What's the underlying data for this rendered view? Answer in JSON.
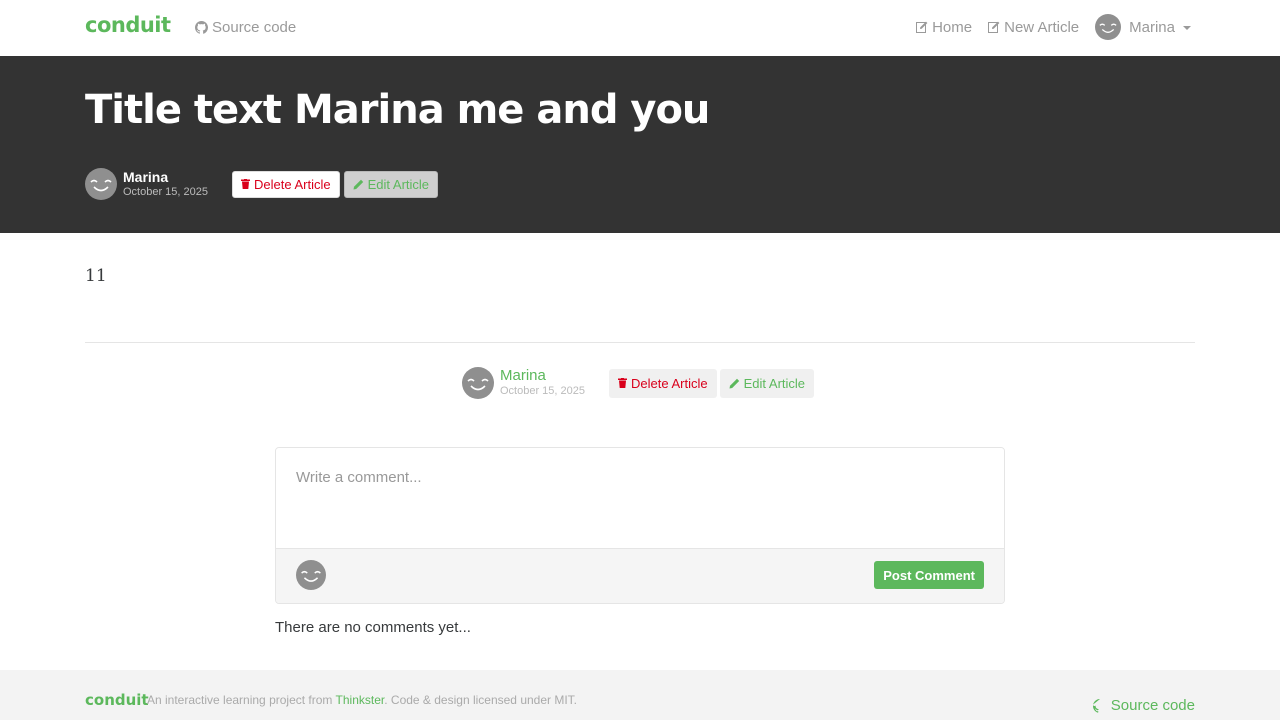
{
  "nav": {
    "brand": "conduit",
    "source_code": "Source code",
    "home": "Home",
    "new_article": "New Article",
    "user": "Marina"
  },
  "article": {
    "title": "Title text Marina me and you",
    "author": "Marina",
    "date": "October 15, 2025",
    "body": "11",
    "delete_label": "Delete Article",
    "edit_label": "Edit Article"
  },
  "comments": {
    "placeholder": "Write a comment...",
    "post_label": "Post Comment",
    "empty_text": "There are no comments yet..."
  },
  "footer": {
    "brand": "conduit",
    "text_before": "An interactive learning project from ",
    "link_text": "Thinkster",
    "text_after": ". Code & design licensed under MIT.",
    "source_code": "Source code"
  },
  "colors": {
    "brand_green": "#5cb85c",
    "danger_red": "#d9001b",
    "banner_bg": "#333333"
  }
}
